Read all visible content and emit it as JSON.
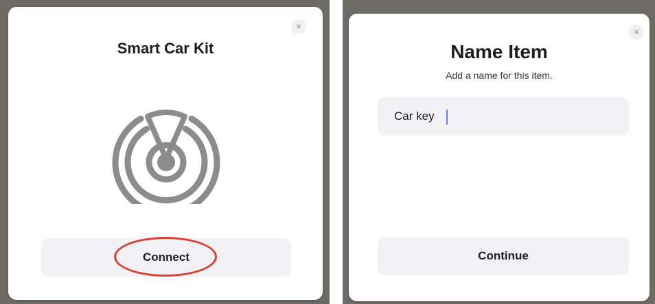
{
  "left_dialog": {
    "title": "Smart Car Kit",
    "close_glyph": "×",
    "radar_icon": "radar-icon",
    "connect_label": "Connect",
    "highlight_color": "#d94032"
  },
  "right_dialog": {
    "title": "Name Item",
    "subtitle": "Add a name for this item.",
    "close_glyph": "×",
    "name_value": "Car key",
    "continue_label": "Continue"
  },
  "colors": {
    "button_bg": "#f2f2f4",
    "text": "#1d1d1f",
    "icon_gray": "#8c8c8c",
    "caret": "#6c7cff"
  }
}
